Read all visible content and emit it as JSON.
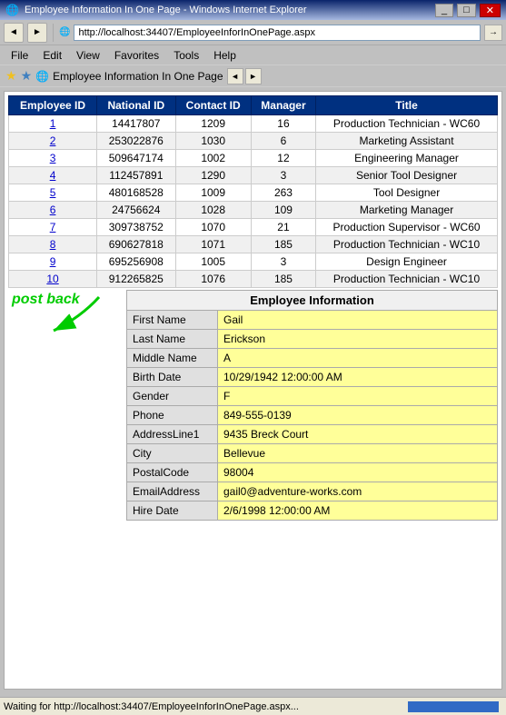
{
  "titleBar": {
    "label": "Employee Information In One Page - Windows Internet Explorer"
  },
  "addressBar": {
    "url": "http://localhost:34407/EmployeeInforInOnePage.aspx"
  },
  "favoritesBar": {
    "label": "Employee Information In One Page"
  },
  "menu": {
    "items": [
      "File",
      "Edit",
      "View",
      "Favorites",
      "Tools",
      "Help"
    ]
  },
  "table": {
    "headers": [
      "Employee ID",
      "National ID",
      "Contact ID",
      "Manager",
      "Title"
    ],
    "rows": [
      {
        "id": "1",
        "nationalId": "14417807",
        "contactId": "1209",
        "manager": "16",
        "title": "Production Technician - WC60"
      },
      {
        "id": "2",
        "nationalId": "253022876",
        "contactId": "1030",
        "manager": "6",
        "title": "Marketing Assistant"
      },
      {
        "id": "3",
        "nationalId": "509647174",
        "contactId": "1002",
        "manager": "12",
        "title": "Engineering Manager"
      },
      {
        "id": "4",
        "nationalId": "112457891",
        "contactId": "1290",
        "manager": "3",
        "title": "Senior Tool Designer"
      },
      {
        "id": "5",
        "nationalId": "480168528",
        "contactId": "1009",
        "manager": "263",
        "title": "Tool Designer"
      },
      {
        "id": "6",
        "nationalId": "24756624",
        "contactId": "1028",
        "manager": "109",
        "title": "Marketing Manager"
      },
      {
        "id": "7",
        "nationalId": "309738752",
        "contactId": "1070",
        "manager": "21",
        "title": "Production Supervisor - WC60"
      },
      {
        "id": "8",
        "nationalId": "690627818",
        "contactId": "1071",
        "manager": "185",
        "title": "Production Technician - WC10"
      },
      {
        "id": "9",
        "nationalId": "695256908",
        "contactId": "1005",
        "manager": "3",
        "title": "Design Engineer"
      },
      {
        "id": "10",
        "nationalId": "912265825",
        "contactId": "1076",
        "manager": "185",
        "title": "Production Technician - WC10"
      }
    ]
  },
  "postback": {
    "label": "post back"
  },
  "infoPanel": {
    "title": "Employee Information",
    "fields": [
      {
        "label": "First Name",
        "value": "Gail"
      },
      {
        "label": "Last Name",
        "value": "Erickson"
      },
      {
        "label": "Middle Name",
        "value": "A"
      },
      {
        "label": "Birth Date",
        "value": "10/29/1942 12:00:00 AM"
      },
      {
        "label": "Gender",
        "value": "F"
      },
      {
        "label": "Phone",
        "value": "849-555-0139"
      },
      {
        "label": "AddressLine1",
        "value": "9435 Breck Court"
      },
      {
        "label": "City",
        "value": "Bellevue"
      },
      {
        "label": "PostalCode",
        "value": "98004"
      },
      {
        "label": "EmailAddress",
        "value": "gail0@adventure-works.com"
      },
      {
        "label": "Hire Date",
        "value": "2/6/1998 12:00:00 AM"
      }
    ]
  },
  "statusBar": {
    "text": "Waiting for http://localhost:34407/EmployeeInforInOnePage.aspx..."
  },
  "icons": {
    "back": "◄",
    "forward": "►",
    "refresh": "↺",
    "home": "⌂",
    "go": "→"
  }
}
